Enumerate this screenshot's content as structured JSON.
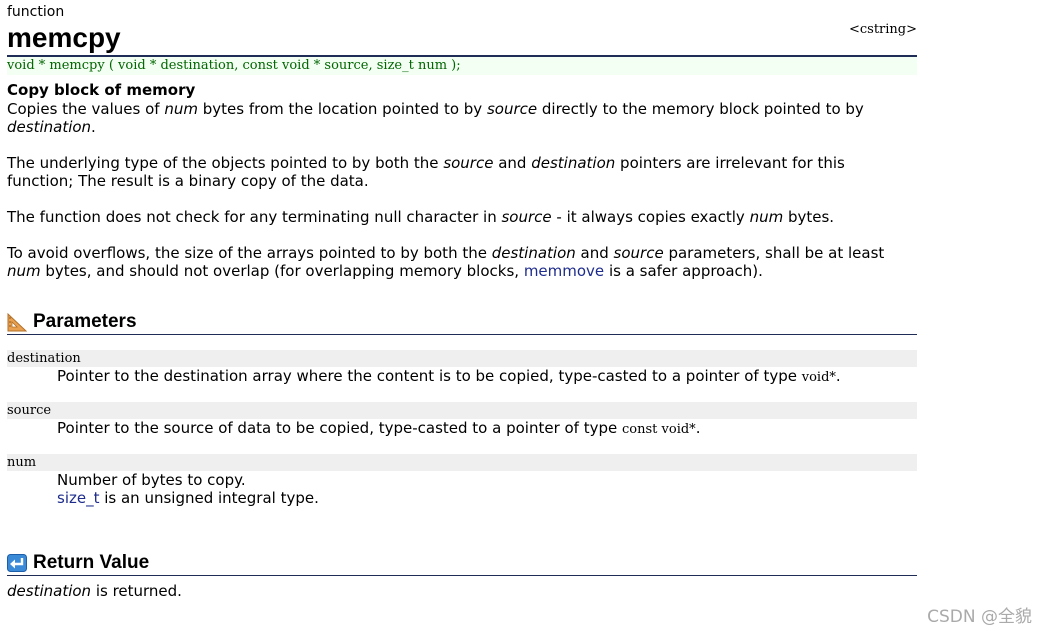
{
  "header": {
    "kind": "function",
    "title": "memcpy",
    "library": "<cstring>",
    "prototype": "void * memcpy ( void * destination, const void * source, size_t num );"
  },
  "description": {
    "subtitle": "Copy block of memory",
    "p1": {
      "a": "Copies the values of ",
      "b": "num",
      "c": " bytes from the location pointed to by ",
      "d": "source",
      "e": " directly to the memory block pointed to by",
      "f": "destination",
      "g": "."
    },
    "p2": {
      "a": "The underlying type of the objects pointed to by both the ",
      "b": "source",
      "c": " and ",
      "d": "destination",
      "e": " pointers are irrelevant for this",
      "f": "function; The result is a binary copy of the data."
    },
    "p3": {
      "a": "The function does not check for any terminating null character in ",
      "b": "source",
      "c": " - it always copies exactly ",
      "d": "num",
      "e": " bytes."
    },
    "p4": {
      "a": "To avoid overflows, the size of the arrays pointed to by both the ",
      "b": "destination",
      "c": " and ",
      "d": "source",
      "e": " parameters, shall be at least",
      "f": "num",
      "g": " bytes, and should not overlap (for overlapping memory blocks, ",
      "h": "memmove",
      "i": " is a safer approach)."
    }
  },
  "parameters": {
    "heading": "Parameters",
    "destination": {
      "name": "destination",
      "desc": "Pointer to the destination array where the content is to be copied, type-casted to a pointer of type ",
      "type": "void*",
      "end": "."
    },
    "source": {
      "name": "source",
      "desc": "Pointer to the source of data to be copied, type-casted to a pointer of type ",
      "type": "const void*",
      "end": "."
    },
    "num": {
      "name": "num",
      "desc": "Number of bytes to copy.",
      "link": "size_t",
      "rest": " is an unsigned integral type."
    }
  },
  "return_value": {
    "heading": "Return Value",
    "name": "destination",
    "rest": " is returned."
  },
  "watermark": "CSDN @全貌",
  "colors": {
    "prototype_text": "#006600",
    "prototype_bg": "#f4fff4",
    "link": "#1e2c8c",
    "rule": "#1f2d56",
    "param_bg": "#efefef"
  }
}
